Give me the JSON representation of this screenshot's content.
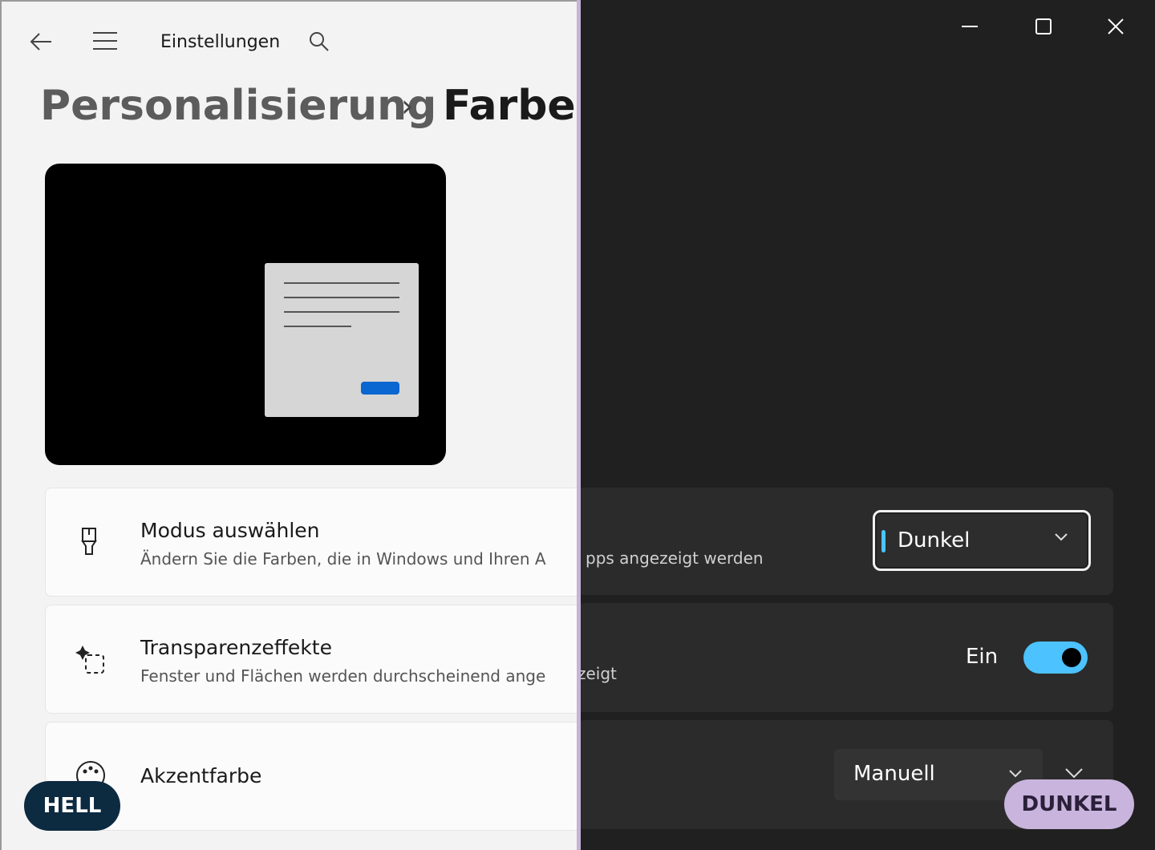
{
  "app": {
    "title": "Einstellungen"
  },
  "breadcrumb": {
    "parent": "Personalisierung",
    "separator": "›",
    "current": "Farben"
  },
  "settings": {
    "mode": {
      "title": "Modus auswählen",
      "description_light": "Ändern Sie die Farben, die in Windows und Ihren A",
      "description_dark": "pps angezeigt werden",
      "value": "Dunkel"
    },
    "transparency": {
      "title": "Transparenzeffekte",
      "description_light": "Fenster und Flächen werden durchscheinend ange",
      "description_dark": "zeigt",
      "state_label": "Ein",
      "enabled": true
    },
    "accent": {
      "title": "Akzentfarbe",
      "value": "Manuell"
    }
  },
  "labels": {
    "light": "HELL",
    "dark": "DUNKEL"
  },
  "colors": {
    "accent": "#4cc2ff",
    "light_bg": "#f3f3f3",
    "dark_bg": "#202020",
    "preview_button": "#0a66d0"
  }
}
